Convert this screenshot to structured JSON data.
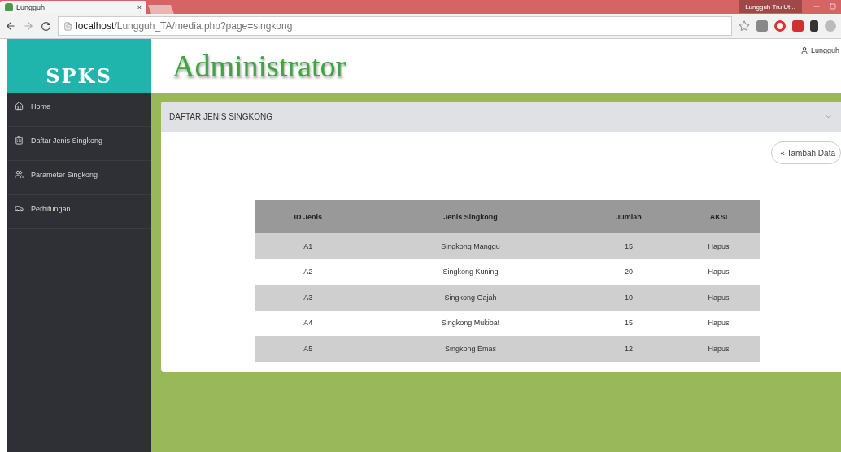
{
  "browser": {
    "tab_title": "Lungguh",
    "tab_close": "×",
    "profile": "Lungguh Tru Ut...",
    "url_host": "localhost",
    "url_path": "/Lungguh_TA/media.php?page=singkong"
  },
  "brand": "SPKS",
  "header": {
    "title": "Administrator",
    "user": "Lungguh"
  },
  "sidebar": {
    "items": [
      {
        "label": "Home",
        "selected": false
      },
      {
        "label": "Daftar Jenis Singkong",
        "selected": false
      },
      {
        "label": "Parameter Singkong",
        "selected": false
      },
      {
        "label": "Perhitungan",
        "selected": false
      }
    ]
  },
  "panel": {
    "title": "DAFTAR JENIS SINGKONG",
    "add_button": "« Tambah Data",
    "table": {
      "columns": [
        "ID Jenis",
        "Jenis Singkong",
        "Jumlah",
        "AKSI"
      ],
      "rows": [
        [
          "A1",
          "Singkong Manggu",
          "15",
          "Hapus"
        ],
        [
          "A2",
          "Singkong Kuning",
          "20",
          "Hapus"
        ],
        [
          "A3",
          "Singkong Gajah",
          "10",
          "Hapus"
        ],
        [
          "A4",
          "Singkong Mukibat",
          "15",
          "Hapus"
        ],
        [
          "A5",
          "Singkong Emas",
          "12",
          "Hapus"
        ]
      ]
    }
  }
}
